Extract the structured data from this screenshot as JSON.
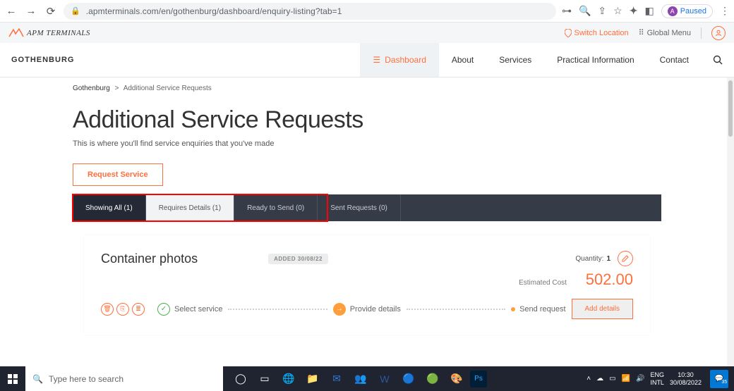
{
  "browser": {
    "url": ".apmterminals.com/en/gothenburg/dashboard/enquiry-listing?tab=1",
    "paused_label": "Paused",
    "avatar_initial": "A"
  },
  "util": {
    "brand": "APM TERMINALS",
    "switch_location": "Switch Location",
    "global_menu": "Global Menu"
  },
  "nav": {
    "location": "GOTHENBURG",
    "dashboard": "Dashboard",
    "about": "About",
    "services": "Services",
    "practical": "Practical Information",
    "contact": "Contact"
  },
  "breadcrumb": {
    "root": "Gothenburg",
    "sep": ">",
    "current": "Additional Service Requests"
  },
  "page": {
    "title": "Additional Service Requests",
    "subtitle": "This is where you'll find service enquiries that you've made",
    "request_btn": "Request Service"
  },
  "tabs": {
    "all": "Showing All (1)",
    "requires": "Requires Details (1)",
    "ready": "Ready to Send (0)",
    "sent": "Sent Requests (0)"
  },
  "card": {
    "title": "Container photos",
    "date_pill": "ADDED 30/08/22",
    "qty_label": "Quantity:",
    "qty_value": "1",
    "cost_label": "Estimated Cost",
    "cost_value": "502.00",
    "step1": "Select service",
    "step2": "Provide details",
    "step3": "Send request",
    "add_details": "Add details"
  },
  "taskbar": {
    "search_placeholder": "Type here to search",
    "lang1": "ENG",
    "lang2": "INTL",
    "time": "10:30",
    "date": "30/08/2022",
    "notif_count": "35"
  }
}
